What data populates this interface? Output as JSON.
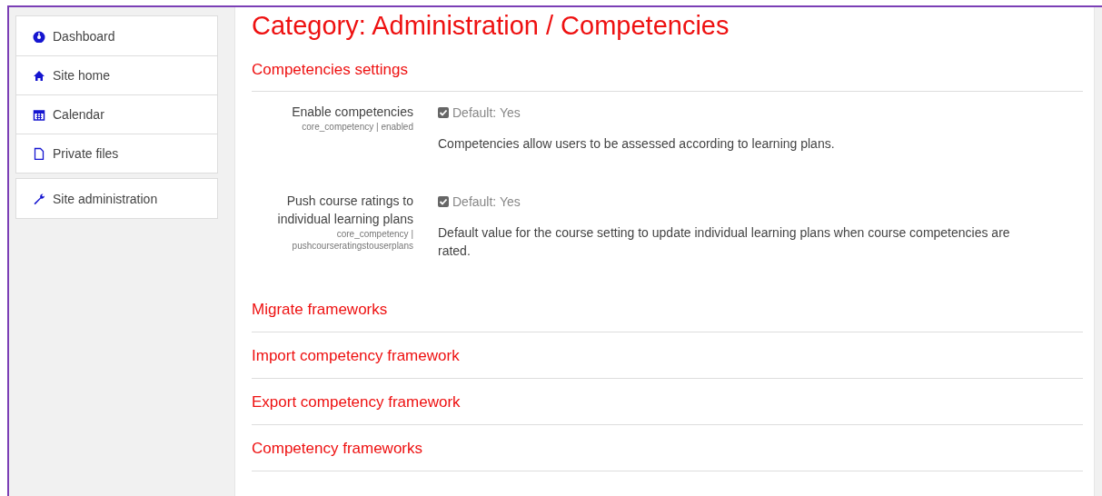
{
  "sidebar": {
    "groups": [
      {
        "items": [
          {
            "label": "Dashboard"
          },
          {
            "label": "Site home"
          },
          {
            "label": "Calendar"
          },
          {
            "label": "Private files"
          }
        ]
      },
      {
        "items": [
          {
            "label": "Site administration"
          }
        ]
      }
    ]
  },
  "page": {
    "title": "Category: Administration / Competencies",
    "settings_section": {
      "heading": "Competencies settings",
      "settings": [
        {
          "label": "Enable competencies",
          "key": "core_competency | enabled",
          "default": "Default: Yes",
          "checked": true,
          "description": "Competencies allow users to be assessed according to learning plans."
        },
        {
          "label": "Push course ratings to individual learning plans",
          "key": "core_competency | pushcourseratingstouserplans",
          "default": "Default: Yes",
          "checked": true,
          "description": "Default value for the course setting to update individual learning plans when course competencies are rated."
        }
      ]
    },
    "sections": [
      "Migrate frameworks",
      "Import competency framework",
      "Export competency framework",
      "Competency frameworks"
    ]
  }
}
